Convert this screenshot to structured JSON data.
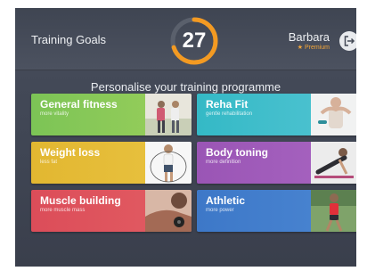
{
  "header": {
    "title": "Training Goals",
    "counter": "27",
    "counter_progress": 0.7,
    "user_name": "Barbara",
    "user_badge": "★ Premium",
    "accent": "#f39a22",
    "logout_icon": "logout-icon"
  },
  "main": {
    "subtitle": "Personalise your training programme",
    "cards": [
      {
        "name": "General fitness",
        "desc": "more vitality",
        "color": "#7cc456"
      },
      {
        "name": "Reha Fit",
        "desc": "gentle rehabilitation",
        "color": "#34b9c6"
      },
      {
        "name": "Weight loss",
        "desc": "less fat",
        "color": "#e2b731"
      },
      {
        "name": "Body toning",
        "desc": "more definition",
        "color": "#9a55b5"
      },
      {
        "name": "Muscle building",
        "desc": "more muscle mass",
        "color": "#dc4d59"
      },
      {
        "name": "Athletic",
        "desc": "more power",
        "color": "#3d78c8"
      }
    ]
  }
}
